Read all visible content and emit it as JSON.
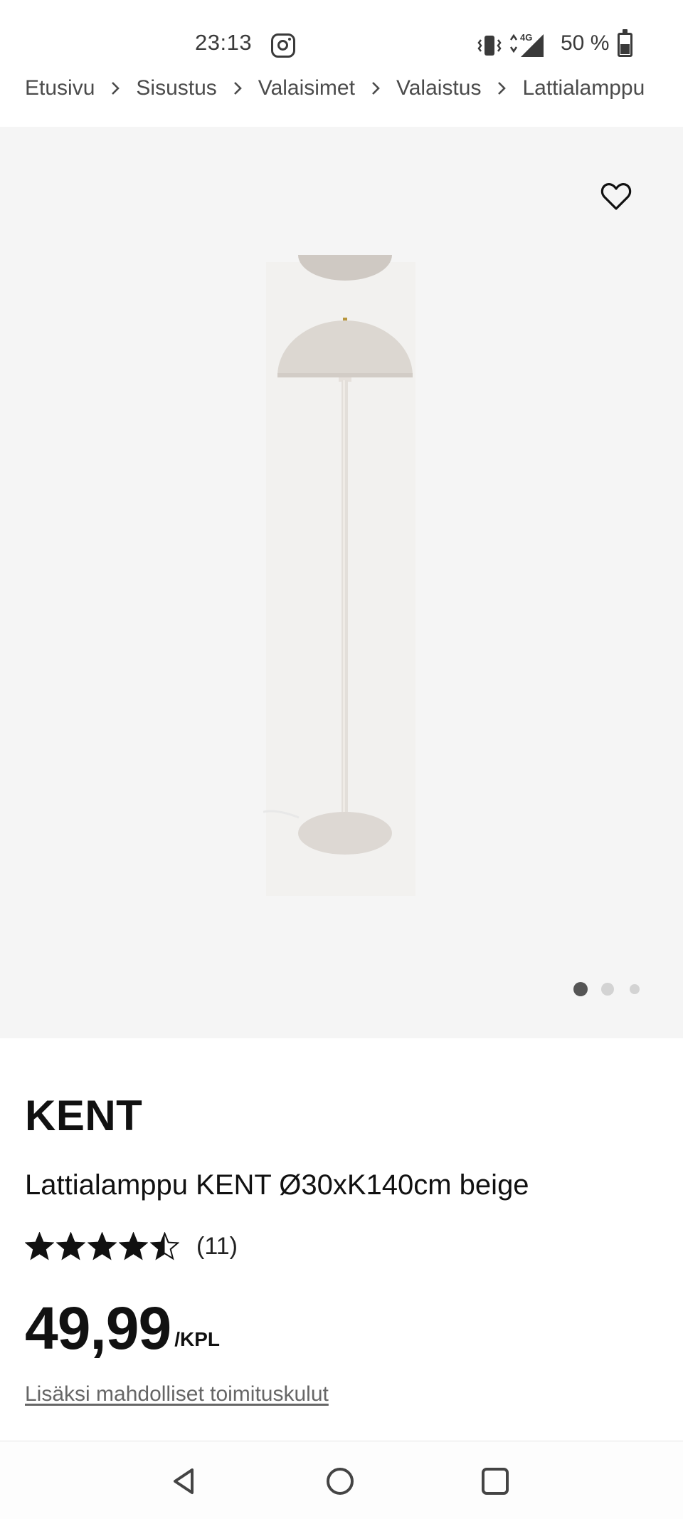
{
  "status_bar": {
    "time": "23:13",
    "battery": "50 %",
    "battery_level": 0.5,
    "network": "4G",
    "icons": [
      "instagram-icon",
      "vibrate-icon",
      "network-4g-icon",
      "battery-icon"
    ]
  },
  "breadcrumb": {
    "items": [
      "Etusivu",
      "Sisustus",
      "Valaisimet",
      "Valaistus",
      "Lattialamppu"
    ]
  },
  "gallery": {
    "total_images": 3,
    "active_index": 0,
    "favorite_icon": "heart-outline-icon"
  },
  "product": {
    "brand": "KENT",
    "name": "Lattialamppu KENT Ø30xK140cm beige",
    "rating": 4.5,
    "rating_max": 5,
    "review_count": "(11)",
    "price": "49,99",
    "unit": "/KPL",
    "shipping_note": "Lisäksi mahdolliset toimituskulut"
  },
  "nav_bar": {
    "icons": [
      "back-icon",
      "home-icon",
      "recents-icon"
    ]
  },
  "colors": {
    "text": "#111111",
    "muted": "#4b4b4b",
    "image_bg": "#f5f5f5",
    "lamp": "#dcd7d1",
    "dot_active": "#555555",
    "dot_inactive": "#d3d3d3"
  }
}
